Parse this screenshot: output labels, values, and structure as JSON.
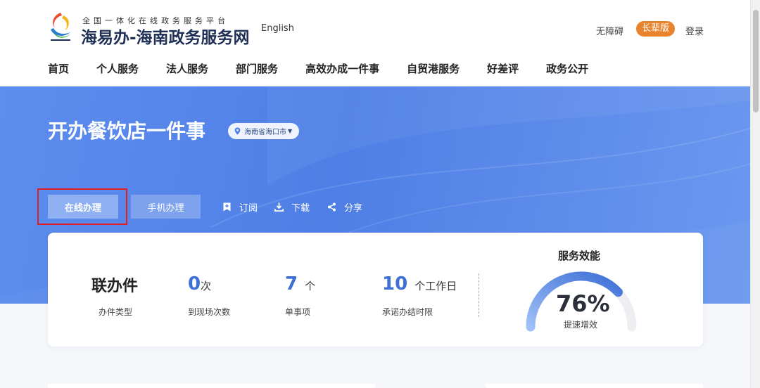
{
  "header": {
    "logo_subtitle": "全国一体化在线政务服务平台",
    "logo_title": "海易办-海南政务服务网",
    "language_link": "English",
    "accessibility": "无障碍",
    "elder_mode": "长辈版",
    "login": "登录"
  },
  "nav": {
    "items": [
      "首页",
      "个人服务",
      "法人服务",
      "部门服务",
      "高效办成一件事",
      "自贸港服务",
      "好差评",
      "政务公开"
    ]
  },
  "banner": {
    "title": "开办餐饮店一件事",
    "location": "海南省海口市",
    "buttons": {
      "online": "在线办理",
      "mobile": "手机办理"
    },
    "actions": {
      "subscribe": "订阅",
      "download": "下载",
      "share": "分享"
    }
  },
  "stats": {
    "type": {
      "value": "联办件",
      "label": "办件类型"
    },
    "visits": {
      "value": "0",
      "unit": "次",
      "label": "到现场次数"
    },
    "items": {
      "value": "7",
      "unit": "个",
      "label": "单事项"
    },
    "time_limit": {
      "value": "10",
      "unit": "个工作日",
      "label": "承诺办结时限"
    }
  },
  "efficiency": {
    "title": "服务效能",
    "value_text": "76%",
    "value": 0.76,
    "caption": "提速增效"
  },
  "colors": {
    "banner": "#4f7fe6",
    "accent_number": "#3d6fd6",
    "elder_badge": "#e8832c",
    "highlight": "#e02020"
  }
}
